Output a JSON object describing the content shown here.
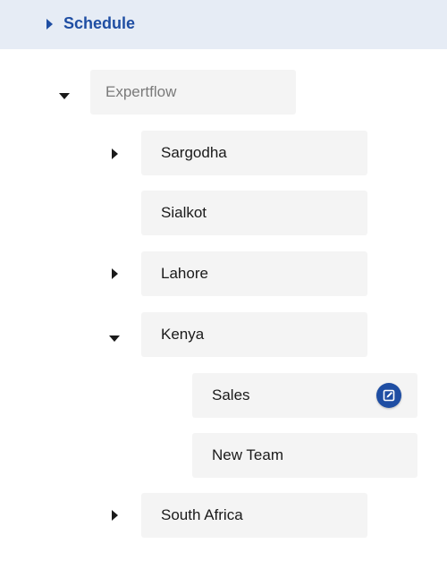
{
  "header": {
    "title": "Schedule",
    "toggle_icon": "chevron-right-icon",
    "accent_color": "#1f4ea3"
  },
  "tree": {
    "root": {
      "label": "Expertflow",
      "state": "expanded"
    },
    "children": [
      {
        "label": "Sargodha",
        "state": "collapsed"
      },
      {
        "label": "Sialkot",
        "state": "leaf"
      },
      {
        "label": "Lahore",
        "state": "collapsed"
      },
      {
        "label": "Kenya",
        "state": "expanded",
        "children": [
          {
            "label": "Sales",
            "action_icon": "edit-icon"
          },
          {
            "label": "New Team"
          }
        ]
      },
      {
        "label": "South Africa",
        "state": "collapsed"
      }
    ]
  }
}
